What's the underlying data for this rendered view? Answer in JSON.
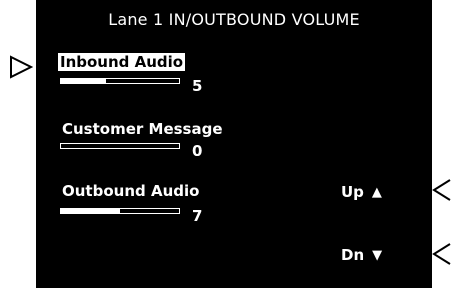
{
  "screen": {
    "title": "Lane 1 IN/OUTBOUND VOLUME"
  },
  "items": [
    {
      "label": "Inbound Audio",
      "value": "5",
      "level": 0.38,
      "selected": true
    },
    {
      "label": "Customer Message",
      "value": "0",
      "level": 0.0,
      "selected": false
    },
    {
      "label": "Outbound Audio",
      "value": "7",
      "level": 0.5,
      "selected": false
    }
  ],
  "buttons": {
    "up_label": "Up",
    "up_icon": "triangle-up-icon",
    "dn_label": "Dn",
    "dn_icon": "triangle-down-icon"
  },
  "pointers": {
    "left_icon": "pointer-right-icon",
    "right_icon": "pointer-left-icon"
  },
  "colors": {
    "background": "#000000",
    "foreground": "#ffffff"
  }
}
